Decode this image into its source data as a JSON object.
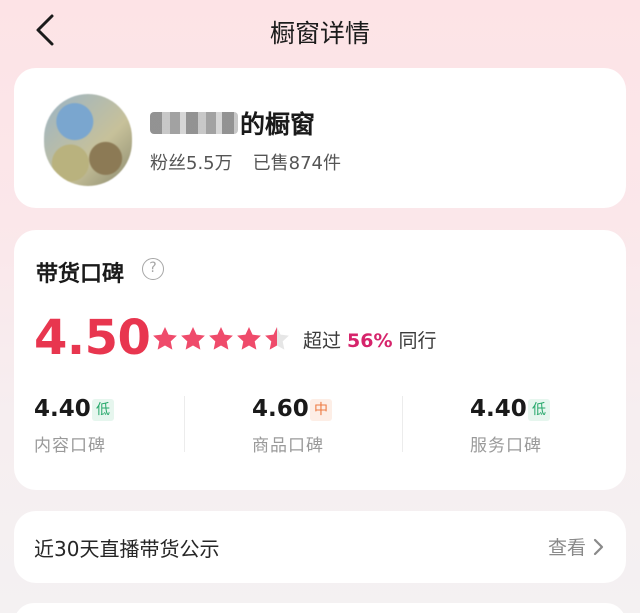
{
  "header": {
    "title": "橱窗详情",
    "back_icon": "chevron-left-icon"
  },
  "shop": {
    "name_suffix": "的橱窗",
    "fans": "粉丝5.5万",
    "sold": "已售874件"
  },
  "reputation": {
    "title": "带货口碑",
    "help_icon": "question-circle-icon",
    "score": "4.50",
    "stars": 4.5,
    "compare_prefix": "超过",
    "compare_pct": "56%",
    "compare_suffix": "同行",
    "subscores": [
      {
        "value": "4.40",
        "tag": "低",
        "label": "内容口碑"
      },
      {
        "value": "4.60",
        "tag": "中",
        "label": "商品口碑"
      },
      {
        "value": "4.40",
        "tag": "低",
        "label": "服务口碑"
      }
    ]
  },
  "live": {
    "title": "近30天直播带货公示",
    "link_label": "查看",
    "link_icon": "chevron-right-icon"
  },
  "colors": {
    "accent": "#e8364f",
    "star": "#ef4b6b",
    "low_tag": "#27a86b",
    "mid_tag": "#ed7a42"
  }
}
